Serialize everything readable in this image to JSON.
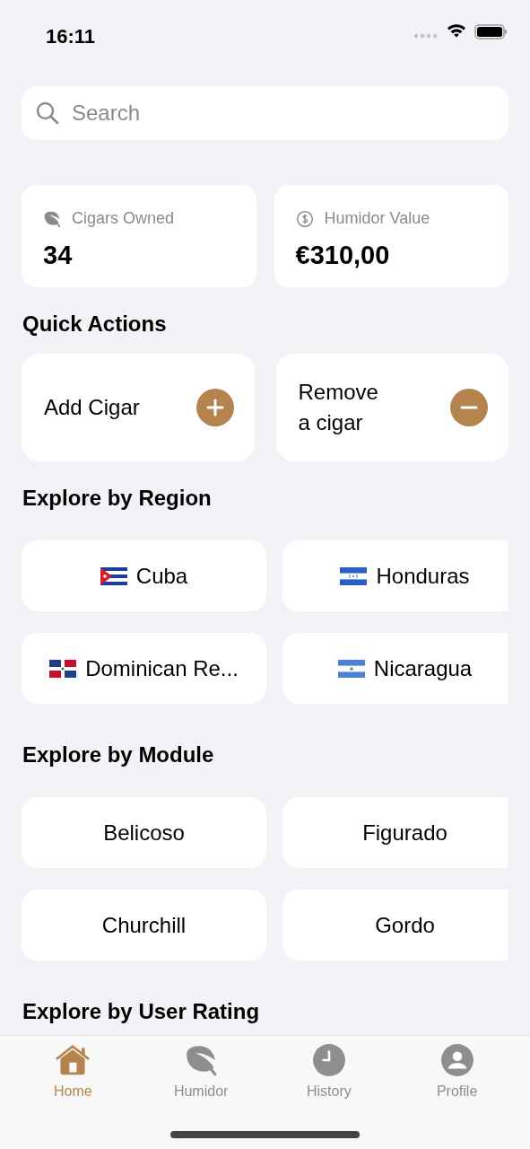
{
  "status_bar": {
    "time": "16:11"
  },
  "search": {
    "placeholder": "Search"
  },
  "stats": [
    {
      "label": "Cigars Owned",
      "value": "34",
      "kind": "leaf"
    },
    {
      "label": "Humidor Value",
      "value": "€310,00",
      "kind": "dollar"
    }
  ],
  "quick_actions": {
    "title": "Quick Actions",
    "items": [
      {
        "label": "Add Cigar",
        "kind": "add"
      },
      {
        "label": "Remove a cigar",
        "kind": "remove"
      }
    ]
  },
  "regions": {
    "title": "Explore by Region",
    "items": [
      {
        "label": "Cuba"
      },
      {
        "label": "Honduras"
      },
      {
        "label": "Dominican Re..."
      },
      {
        "label": "Nicaragua"
      }
    ]
  },
  "modules": {
    "title": "Explore by Module",
    "items": [
      {
        "label": "Belicoso"
      },
      {
        "label": "Figurado"
      },
      {
        "label": "Churchill"
      },
      {
        "label": "Gordo"
      }
    ]
  },
  "ratings": {
    "title": "Explore by User Rating"
  },
  "tab_bar": [
    {
      "label": "Home",
      "kind": "home",
      "selected": true
    },
    {
      "label": "Humidor",
      "kind": "leaf",
      "selected": false
    },
    {
      "label": "History",
      "kind": "clock",
      "selected": false
    },
    {
      "label": "Profile",
      "kind": "person",
      "selected": false
    }
  ]
}
